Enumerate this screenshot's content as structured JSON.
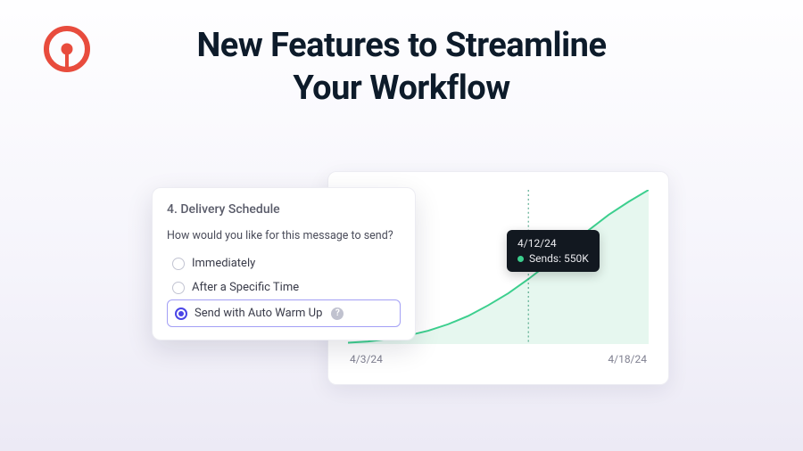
{
  "brand": {
    "accent": "#e84c3d"
  },
  "title": "New Features to Streamline\nYour Workflow",
  "panel": {
    "heading": "4. Delivery Schedule",
    "question": "How would you like for this message to send?",
    "options": [
      {
        "label": "Immediately",
        "selected": false
      },
      {
        "label": "After a Specific Time",
        "selected": false
      },
      {
        "label": "Send with Auto Warm Up",
        "selected": true,
        "help": true
      }
    ]
  },
  "chart_data": {
    "type": "area",
    "title": "",
    "xlabel": "",
    "ylabel": "",
    "x_start_label": "4/3/24",
    "x_end_label": "4/18/24",
    "ylim": [
      0,
      1300000
    ],
    "x": [
      "4/3/24",
      "4/4/24",
      "4/5/24",
      "4/6/24",
      "4/7/24",
      "4/8/24",
      "4/9/24",
      "4/10/24",
      "4/11/24",
      "4/12/24",
      "4/13/24",
      "4/14/24",
      "4/15/24",
      "4/16/24",
      "4/17/24",
      "4/18/24"
    ],
    "values": [
      15000,
      25000,
      45000,
      75000,
      115000,
      170000,
      240000,
      330000,
      430000,
      550000,
      680000,
      820000,
      960000,
      1090000,
      1200000,
      1300000
    ],
    "series_color": "#3ccf8e",
    "fill_color": "#e6f7ef",
    "marker": {
      "x": "4/12/24",
      "date_label": "4/12/24",
      "value_label": "Sends: 550K"
    }
  }
}
